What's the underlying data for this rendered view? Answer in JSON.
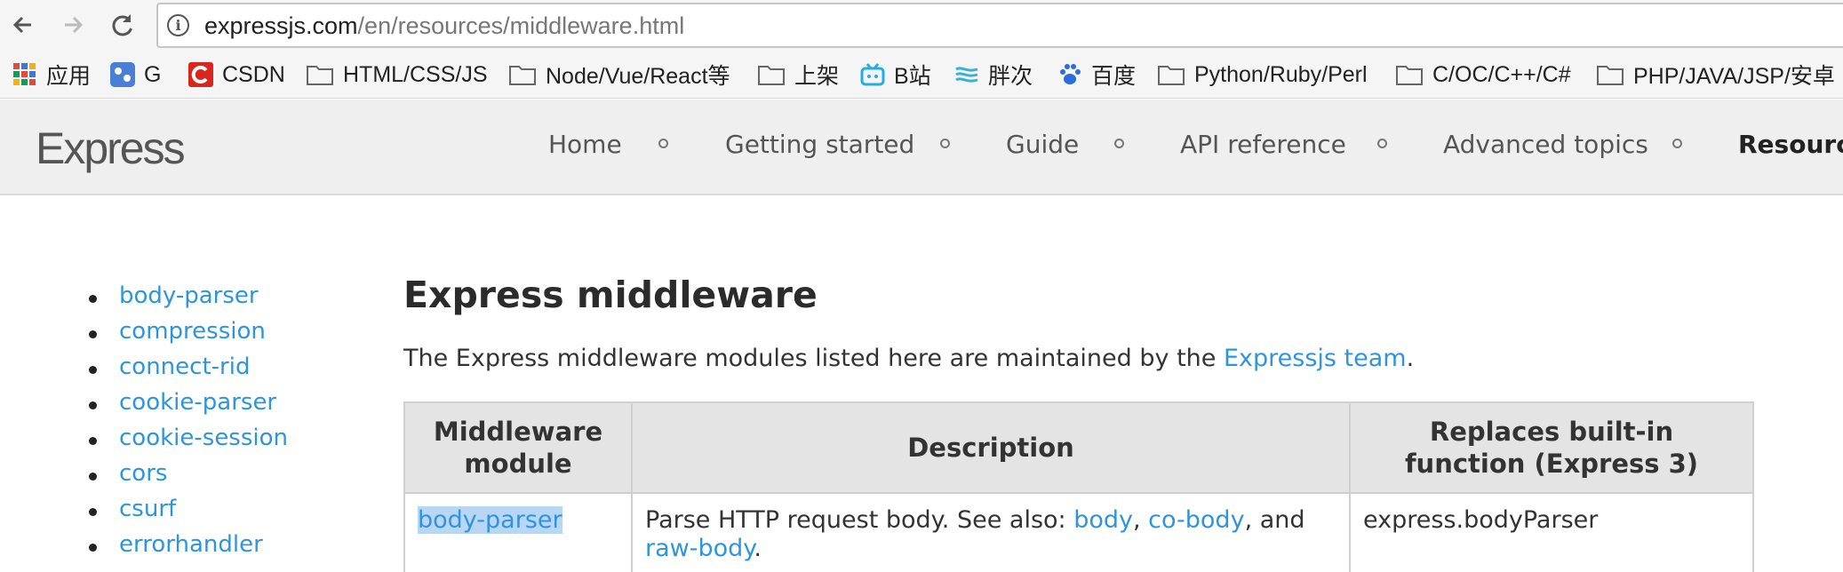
{
  "browser": {
    "url_host": "expressjs.com",
    "url_path": "/en/resources/middleware.html",
    "bookmarks": [
      {
        "label": "应用",
        "icon": "apps-grid-icon"
      },
      {
        "label": "G",
        "icon": "g-blue-icon"
      },
      {
        "label": "CSDN",
        "icon": "csdn-icon"
      },
      {
        "label": "HTML/CSS/JS",
        "icon": "folder-icon"
      },
      {
        "label": "Node/Vue/React等",
        "icon": "folder-icon"
      },
      {
        "label": "上架",
        "icon": "folder-icon"
      },
      {
        "label": "B站",
        "icon": "bilibili-icon"
      },
      {
        "label": "胖次",
        "icon": "wave-icon"
      },
      {
        "label": "百度",
        "icon": "baidu-paw-icon"
      },
      {
        "label": "Python/Ruby/Perl",
        "icon": "folder-icon"
      },
      {
        "label": "C/OC/C++/C#",
        "icon": "folder-icon"
      },
      {
        "label": "PHP/JAVA/JSP/安卓",
        "icon": "folder-icon"
      }
    ]
  },
  "site": {
    "logo": "Express",
    "nav": [
      {
        "label": "Home"
      },
      {
        "label": "Getting started"
      },
      {
        "label": "Guide"
      },
      {
        "label": "API reference"
      },
      {
        "label": "Advanced topics"
      },
      {
        "label": "Resources"
      }
    ],
    "active_nav": "Resources"
  },
  "sidebar": {
    "items": [
      {
        "label": "body-parser"
      },
      {
        "label": "compression"
      },
      {
        "label": "connect-rid"
      },
      {
        "label": "cookie-parser"
      },
      {
        "label": "cookie-session"
      },
      {
        "label": "cors"
      },
      {
        "label": "csurf"
      },
      {
        "label": "errorhandler"
      }
    ]
  },
  "main": {
    "title": "Express middleware",
    "intro_before": "The Express middleware modules listed here are maintained by the ",
    "intro_link": "Expressjs team",
    "intro_after": ".",
    "table": {
      "headers": [
        "Middleware module",
        "Description",
        "Replaces built-in function (Express 3)"
      ],
      "rows": [
        {
          "module": "body-parser",
          "desc_prefix": "Parse HTTP request body. See also: ",
          "desc_links": [
            "body",
            "co-body",
            "raw-body"
          ],
          "desc_sep1": ", ",
          "desc_sep2": ", and",
          "desc_suffix": ".",
          "replaces": "express.bodyParser"
        }
      ]
    }
  },
  "colors": {
    "link": "#2e95dc",
    "selection": "#b9d6f5",
    "header_bg": "#efefef"
  }
}
